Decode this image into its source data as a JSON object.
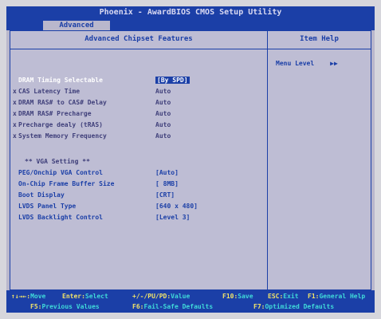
{
  "title": "Phoenix - AwardBIOS CMOS Setup Utility",
  "tab": "Advanced",
  "left_header": "Advanced Chipset Features",
  "right_header": "Item Help",
  "menu_items": [
    {
      "label": "DRAM Timing Selectable",
      "value": "[By SPD]",
      "prefix": ""
    },
    {
      "label": "CAS Latency Time",
      "value": "Auto",
      "prefix": "x"
    },
    {
      "label": "DRAM RAS# to CAS# Delay",
      "value": "Auto",
      "prefix": "x"
    },
    {
      "label": "DRAM RAS# Precharge",
      "value": "Auto",
      "prefix": "x"
    },
    {
      "label": "Precharge dealy (tRAS)",
      "value": "Auto",
      "prefix": "x"
    },
    {
      "label": "System Memory Frequency",
      "value": "Auto",
      "prefix": "x"
    }
  ],
  "vga_section_title": "** VGA Setting **",
  "vga_items": [
    {
      "label": "PEG/Onchip VGA Control",
      "value": "[Auto]"
    },
    {
      "label": "On-Chip Frame Buffer Size",
      "value": "[ 8MB]"
    },
    {
      "label": "Boot Display",
      "value": "[CRT]"
    },
    {
      "label": "LVDS Panel Type",
      "value": "[640 x 480]"
    },
    {
      "label": "LVDS Backlight Control",
      "value": "[Level 3]"
    }
  ],
  "item_help": {
    "menu_level_label": "Menu Level",
    "menu_level_arrows": "▶▶"
  },
  "bottom_bar": {
    "line1": [
      {
        "key": "↑↓→←:",
        "text": "Move"
      },
      {
        "key": "Enter:",
        "text": "Select"
      },
      {
        "key": "+/-/PU/PD:",
        "text": "Value"
      },
      {
        "key": "F10:",
        "text": "Save"
      },
      {
        "key": "ESC:",
        "text": "Exit"
      },
      {
        "key": "F1:",
        "text": "General Help"
      }
    ],
    "line2": [
      {
        "key": "F5:",
        "text": "Previous Values"
      },
      {
        "key": "F6:",
        "text": "Fail-Safe Defaults"
      },
      {
        "key": "F7:",
        "text": "Optimized Defaults"
      }
    ]
  },
  "colors": {
    "bios_blue": "#1b3fa7",
    "panel_bg": "#bebdd4",
    "help_bar_text": "#3fd9d9"
  }
}
